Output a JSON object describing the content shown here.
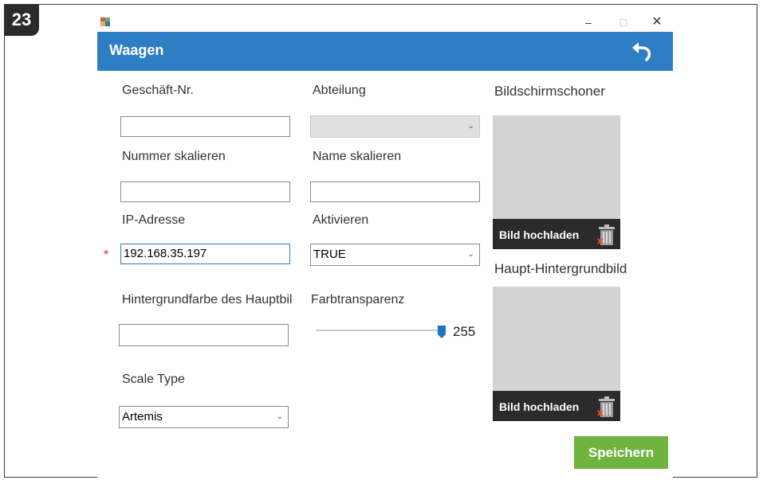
{
  "step_badge": "23",
  "window": {
    "min_glyph": "–",
    "max_glyph": "□",
    "close_glyph": "✕"
  },
  "header": {
    "title": "Waagen",
    "back_icon": "undo-arrow-icon"
  },
  "form": {
    "store_no": {
      "label": "Geschäft-Nr.",
      "value": ""
    },
    "department": {
      "label": "Abteilung",
      "value": ""
    },
    "scale_number": {
      "label": "Nummer skalieren",
      "value": ""
    },
    "scale_name": {
      "label": "Name skalieren",
      "value": ""
    },
    "ip_address": {
      "label": "IP-Adresse",
      "value": "192.168.35.197",
      "required_marker": "*"
    },
    "activate": {
      "label": "Aktivieren",
      "value": "TRUE"
    },
    "bg_color": {
      "label": "Hintergrundfarbe des Hauptbil",
      "value": ""
    },
    "transparency": {
      "label": "Farbtransparenz",
      "value": 255,
      "value_text": "255",
      "max": 255
    },
    "scale_type": {
      "label": "Scale Type",
      "value": "Artemis"
    }
  },
  "screensaver": {
    "label": "Bildschirmschoner",
    "upload_label": "Bild hochladen",
    "icon": "trash-icon"
  },
  "main_background": {
    "label": "Haupt-Hintergrundbild",
    "upload_label": "Bild hochladen",
    "icon": "trash-icon"
  },
  "save_label": "Speichern",
  "colors": {
    "header": "#2e7ec3",
    "save": "#6fb43f",
    "required": "#e02020"
  }
}
